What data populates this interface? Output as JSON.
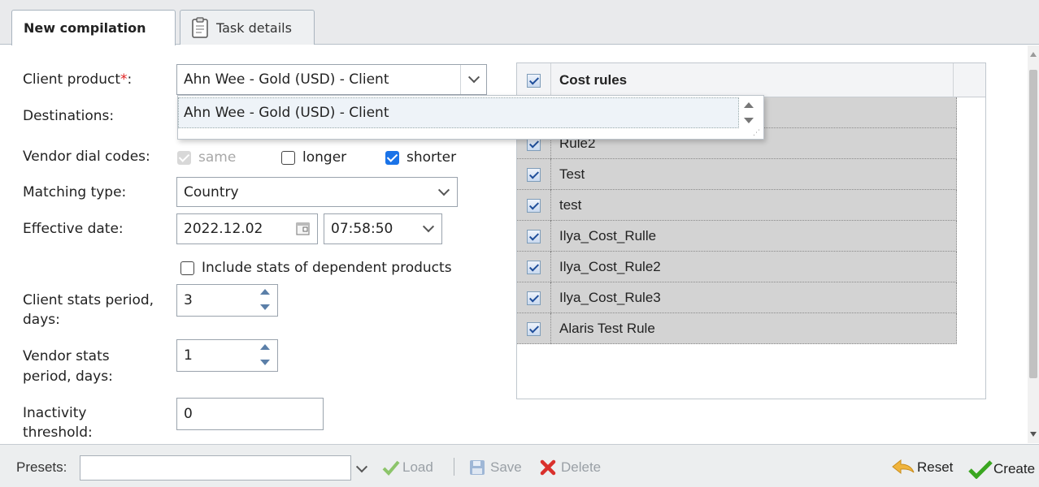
{
  "tabs": [
    {
      "label": "New compilation"
    },
    {
      "label": "Task details"
    }
  ],
  "form": {
    "client_product": {
      "label": "Client product",
      "required_mark": "*",
      "colon": ":",
      "value": "Ahn Wee - Gold (USD) - Client"
    },
    "destinations": {
      "label": "Destinations:"
    },
    "vendor_dial_codes": {
      "label": "Vendor dial codes:",
      "options": [
        {
          "label": "same",
          "checked": true,
          "disabled": true
        },
        {
          "label": "longer",
          "checked": false
        },
        {
          "label": "shorter",
          "checked": true
        }
      ]
    },
    "matching_type": {
      "label": "Matching type:",
      "value": "Country"
    },
    "effective_date": {
      "label": "Effective date:",
      "date": "2022.12.02",
      "time": "07:58:50"
    },
    "include_stats": {
      "label": "Include stats of dependent products",
      "checked": false
    },
    "client_stats": {
      "label_line1": "Client stats period,",
      "label_line2": "days:",
      "value": "3"
    },
    "vendor_stats": {
      "label_line1": "Vendor stats",
      "label_line2": "period, days:",
      "value": "1"
    },
    "inactivity": {
      "label_line1": "Inactivity",
      "label_line2": "threshold:",
      "value": "0"
    }
  },
  "dropdown": {
    "option": "Ahn Wee - Gold (USD) - Client"
  },
  "cost_rules": {
    "header": "Cost rules",
    "rows": [
      "Rule2",
      "Test",
      "test",
      "Ilya_Cost_Rulle",
      "Ilya_Cost_Rule2",
      "Ilya_Cost_Rule3",
      "Alaris Test Rule"
    ]
  },
  "toolbar": {
    "presets_label": "Presets:",
    "load_label": "Load",
    "save_label": "Save",
    "delete_label": "Delete",
    "reset_label": "Reset",
    "create_label": "Create"
  },
  "colors": {
    "accent": "#1a73e8",
    "required": "#e02020",
    "check_green": "#3aa620",
    "delete_red": "#d9302c"
  }
}
